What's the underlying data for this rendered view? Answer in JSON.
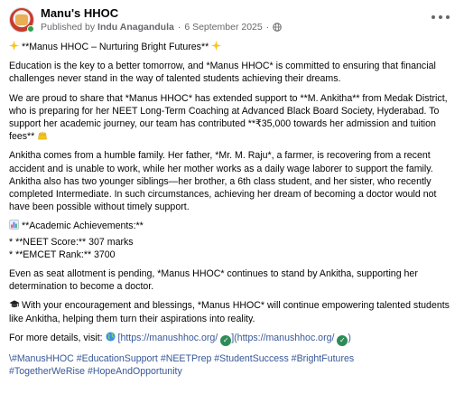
{
  "header": {
    "page_name": "Manu's HHOC",
    "published_prefix": "Published by",
    "author": "Indu Anagandula",
    "date": "6 September 2025",
    "privacy_icon": "globe-icon",
    "more_icon": "more-options-icon"
  },
  "post": {
    "line_title": "**Manus HHOC – Nurturing Bright Futures**",
    "para1": "Education is the key to a better tomorrow, and *Manus HHOC* is committed to ensuring that financial challenges never stand in the way of talented students achieving their dreams.",
    "para2": "We are proud to share that *Manus HHOC* has extended support to **M. Ankitha** from Medak District, who is preparing for her NEET Long-Term Coaching at Advanced Black Board Society, Hyderabad. To support her academic journey, our team has contributed **₹35,000 towards her admission and tuition fees**",
    "para3": "Ankitha comes from a humble family. Her father, *Mr. M. Raju*, a farmer, is recovering from a recent accident and is unable to work, while her mother works as a daily wage laborer to support the family. Ankitha also has two younger siblings—her brother, a 6th class student, and her sister, who recently completed Intermediate. In such circumstances, achieving her dream of becoming a doctor would not have been possible without timely support.",
    "achievements_heading": "**Academic Achievements:**",
    "neet": "* **NEET Score:** 307 marks",
    "emcet": "* **EMCET Rank:** 3700",
    "para4": "Even as seat allotment is pending, *Manus HHOC* continues to stand by Ankitha, supporting her determination to become a doctor.",
    "para5": "With your encouragement and blessings, *Manus HHOC* will continue empowering talented students like Ankitha, helping them turn their aspirations into reality.",
    "details_prefix": "For more details, visit:",
    "link1": "[https://manushhoc.org/",
    "link_mid": "](https://manushhoc.org/",
    "link_end": ")",
    "hashtags_line1": "\\#ManusHHOC #EducationSupport #NEETPrep #StudentSuccess #BrightFutures",
    "hashtags_line2": "#TogetherWeRise #HopeAndOpportunity"
  },
  "emojis": {
    "title": "sparkle-icon",
    "hands": "raised-hands-icon",
    "chart": "bar-chart-icon",
    "grad": "graduation-cap-icon",
    "link_globe": "globe-icon",
    "check": "check-mark-icon"
  },
  "colors": {
    "text": "#050505",
    "muted": "#65676b",
    "link": "#385898",
    "online": "#31a24c",
    "check": "#2e8b57"
  }
}
